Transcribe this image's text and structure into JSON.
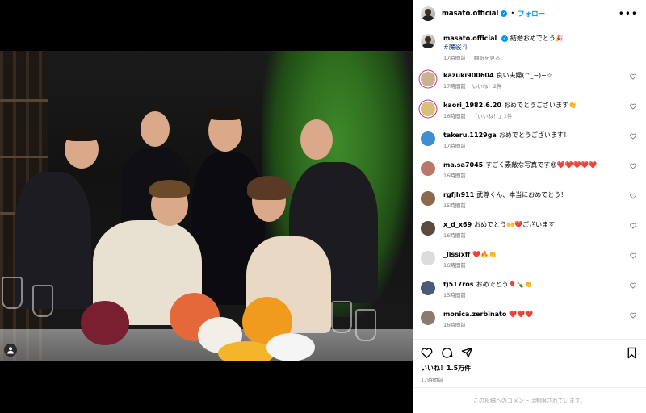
{
  "post": {
    "username": "masato.official",
    "follow_label": "フォロー",
    "separator": "•",
    "more_label": "•••"
  },
  "caption": {
    "username": "masato.official",
    "text": "結婚おめでとう🎉",
    "hashtag": "#魔裟斗",
    "time": "17時間前",
    "translate": "翻訳を見る"
  },
  "comments": [
    {
      "user": "kazuki900604",
      "text": "良い夫婦(^_−)−☆",
      "time": "17時間前",
      "likes": "いいね！2件",
      "avatar_color": "#c9b28f"
    },
    {
      "user": "kaori_1982.6.20",
      "text": "おめでとうございます👏",
      "time": "16時間前",
      "likes": "「いいね！」1件",
      "avatar_color": "#d8c07a"
    },
    {
      "user": "takeru.1129ga",
      "text": "おめでとうございます！",
      "time": "17時間前",
      "likes": "",
      "avatar_color": "#3d8fd1"
    },
    {
      "user": "ma.sa7045",
      "text": "すごく素敵な写真です😍❤️❤️❤️❤️❤️",
      "time": "16時間前",
      "likes": "",
      "avatar_color": "#b97a6a"
    },
    {
      "user": "rgfjh911",
      "text": "武尊くん、本当におめでとう！",
      "time": "15時間前",
      "likes": "",
      "avatar_color": "#8a6a4a"
    },
    {
      "user": "x_d_x69",
      "text": "おめでとう🙌❤️ございます",
      "time": "16時間前",
      "likes": "",
      "avatar_color": "#5a4a40"
    },
    {
      "user": "_llssixff",
      "text": "❤️🔥👏",
      "time": "16時間前",
      "likes": "",
      "avatar_color": "#dcdcdc"
    },
    {
      "user": "tj517ros",
      "text": "おめでとう🎈🍾👏",
      "time": "15時間前",
      "likes": "",
      "avatar_color": "#4a5a7a"
    },
    {
      "user": "monica.zerbinato",
      "text": "❤️❤️❤️",
      "time": "16時間前",
      "likes": "",
      "avatar_color": "#8a7a70"
    }
  ],
  "actions": {
    "like_count": "いいね！1.5万件",
    "time": "17時間前"
  },
  "footer": {
    "text": "この投稿へのコメントは制限されています。"
  },
  "icons": [
    "heart-icon",
    "comment-icon",
    "share-icon",
    "bookmark-icon",
    "tag-user-icon",
    "verified-icon",
    "more-icon"
  ]
}
